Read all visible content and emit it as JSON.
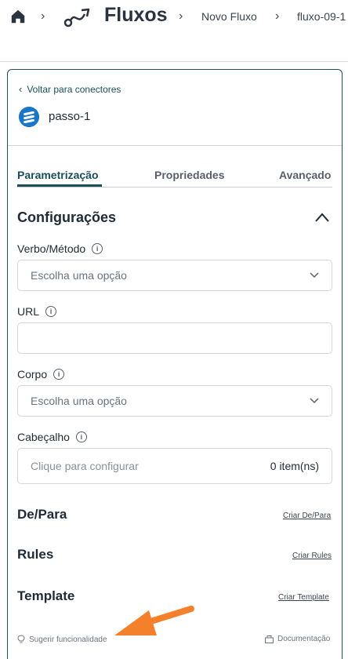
{
  "header": {
    "title": "Fluxos",
    "breadcrumb": [
      "Novo Fluxo",
      "fluxo-09-1"
    ]
  },
  "panel": {
    "back_label": "Voltar para conectores",
    "step_name": "passo-1",
    "tabs": [
      "Parametrização",
      "Propriedades",
      "Avançado"
    ],
    "section_title": "Configurações",
    "fields": {
      "verbo_label": "Verbo/Método",
      "verbo_placeholder": "Escolha uma opção",
      "url_label": "URL",
      "url_value": "",
      "corpo_label": "Corpo",
      "corpo_placeholder": "Escolha uma opção",
      "cabecalho_label": "Cabeçalho",
      "cabecalho_placeholder": "Clique para configurar",
      "cabecalho_count": "0 item(ns)"
    },
    "depara": {
      "title": "De/Para",
      "link": "Criar De/Para"
    },
    "rules": {
      "title": "Rules",
      "link": "Criar Rules"
    },
    "template": {
      "title": "Template",
      "link": "Criar Template"
    },
    "footer": {
      "suggest": "Sugerir funcionalidade",
      "docs": "Documentação"
    }
  },
  "colors": {
    "accent": "#1a4f5a",
    "step_icon": "#1976c9",
    "arrow": "#f5802c"
  },
  "icons": {
    "home": "home-icon",
    "flow": "flow-icon",
    "info": "info-icon",
    "chevron": "chevron-down-icon",
    "lightbulb": "lightbulb-icon",
    "docs": "docs-icon"
  }
}
